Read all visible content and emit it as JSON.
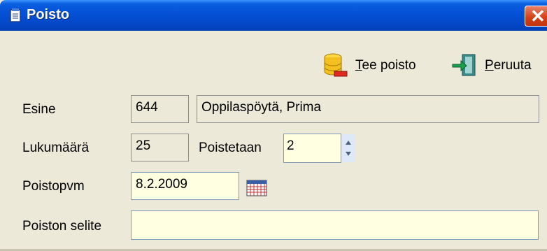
{
  "window": {
    "title": "Poisto"
  },
  "toolbar": {
    "tee_poisto_mnemonic": "T",
    "tee_poisto_rest": "ee poisto",
    "peruuta_mnemonic": "P",
    "peruuta_rest": "eruuta"
  },
  "form": {
    "esine_label": "Esine",
    "esine_id": "644",
    "esine_name": "Oppilaspöytä, Prima",
    "lukumaara_label": "Lukumäärä",
    "lukumaara_value": "25",
    "poistetaan_label": "Poistetaan",
    "poistetaan_value": "2",
    "poistopvm_label": "Poistopvm",
    "poistopvm_value": "8.2.2009",
    "selite_label": "Poiston selite",
    "selite_value": ""
  },
  "colors": {
    "title_bar": "#0552d8",
    "input_bg": "#ffffe1",
    "window_bg": "#ece9d8"
  },
  "icons": [
    "notepad-icon",
    "close-icon",
    "database-delete-icon",
    "exit-door-icon",
    "spinner-icon",
    "calendar-icon"
  ]
}
